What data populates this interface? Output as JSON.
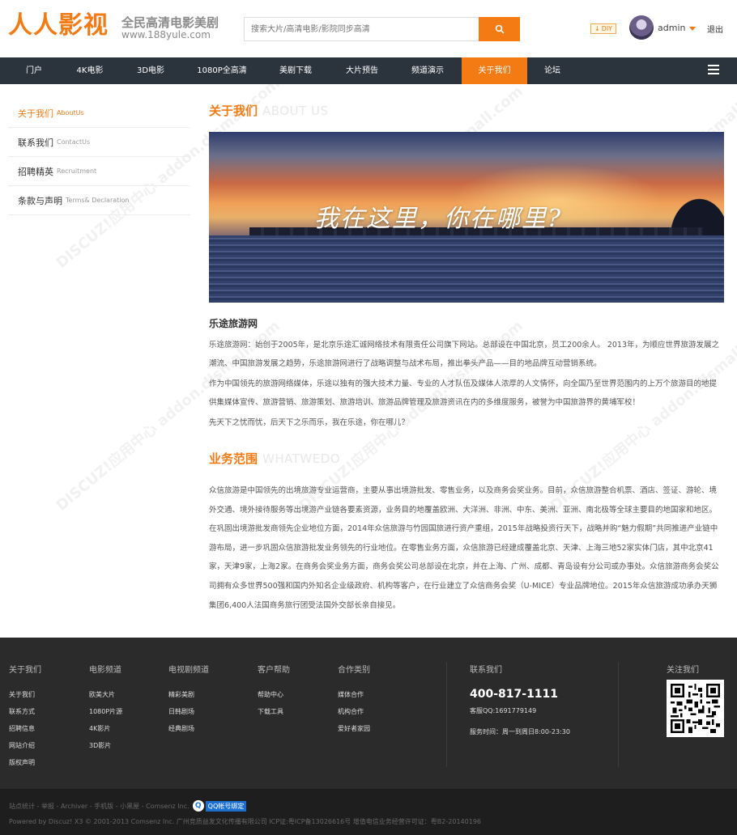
{
  "header": {
    "logo_main": "人人影视",
    "logo_tagline": "全民高清电影美剧",
    "logo_url": "www.188yule.com",
    "search_placeholder": "搜索大片/高清电影/影院同步高清",
    "diy_label": "DIY",
    "username": "admin",
    "logout_label": "退出"
  },
  "nav": {
    "items": [
      {
        "label": "门户"
      },
      {
        "label": "4K电影"
      },
      {
        "label": "3D电影"
      },
      {
        "label": "1080P全高清"
      },
      {
        "label": "美剧下载"
      },
      {
        "label": "大片预告"
      },
      {
        "label": "频道演示"
      },
      {
        "label": "关于我们",
        "active": true
      },
      {
        "label": "论坛"
      }
    ]
  },
  "sidebar": {
    "items": [
      {
        "cn": "关于我们",
        "en": "AboutUs",
        "active": true
      },
      {
        "cn": "联系我们",
        "en": "ContactUs"
      },
      {
        "cn": "招聘精英",
        "en": "Recruitment"
      },
      {
        "cn": "条款与声明",
        "en": "Terms& Declaration"
      }
    ]
  },
  "about": {
    "title_cn": "关于我们",
    "title_en": "ABOUT US",
    "banner_text": "我在这里，你在哪里?",
    "company": "乐途旅游网",
    "paragraphs": [
      "乐途旅游网：始创于2005年，是北京乐途汇诚网络技术有限责任公司旗下网站。总部设在中国北京，员工200余人。 2013年，为顺应世界旅游发展之潮流、中国旅游发展之趋势，乐途旅游网进行了战略调整与战术布局，推出拳头产品——目的地品牌互动营销系统。",
      "作为中国领先的旅游网络媒体，乐途以独有的强大技术力量、专业的人才队伍及媒体人浓厚的人文情怀，向全国乃至世界范围内的上万个旅游目的地提供集媒体宣传、旅游营销、旅游策划、旅游培训、旅游品牌管理及旅游资讯在内的多维度服务，被誉为中国旅游界的黄埔军校！",
      "先天下之忧而忧，后天下之乐而乐，我在乐途，你在哪儿？"
    ]
  },
  "business": {
    "title_cn": "业务范围",
    "title_en": "WHATWEDO",
    "text": "众信旅游是中国领先的出境旅游专业运营商，主要从事出境游批发、零售业务，以及商务会奖业务。目前，众信旅游整合机票、酒店、签证、游轮、境外交通、境外接待服务等出境游产业链各要素资源，业务目的地覆盖欧洲、大洋洲、非洲、中东、美洲、亚洲、南北极等全球主要目的地国家和地区。在巩固出境游批发商领先企业地位方面，2014年众信旅游与竹园国旅进行资产重组，2015年战略投资行天下，战略并购“魅力假期”共同推进产业链中游布局，进一步巩固众信旅游批发业务领先的行业地位。在零售业务方面，众信旅游已经建成覆盖北京、天津、上海三地52家实体门店，其中北京41家，天津9家，上海2家。在商务会奖业务方面，商务会奖公司总部设在北京，并在上海、广州、成都、青岛设有分公司或办事处。众信旅游商务会奖公司拥有众多世界500强和国内外知名企业级政府、机构等客户，在行业建立了众信商务会奖（U-MICE）专业品牌地位。2015年众信旅游成功承办天狮集团6,400人法国商务旅行团受法国外交部长亲自接见。"
  },
  "footer": {
    "cols": [
      {
        "head": "关于我们",
        "links": [
          "关于我们",
          "联系方式",
          "招聘信息",
          "网站介绍",
          "版权声明"
        ]
      },
      {
        "head": "电影频道",
        "links": [
          "欧美大片",
          "1080P片源",
          "4K影片",
          "3D影片"
        ]
      },
      {
        "head": "电视剧频道",
        "links": [
          "精彩美剧",
          "日韩剧场",
          "经典剧场"
        ]
      },
      {
        "head": "客户帮助",
        "links": [
          "帮助中心",
          "下载工具"
        ]
      },
      {
        "head": "合作类别",
        "links": [
          "媒体合作",
          "机构合作",
          "爱好者家园"
        ]
      }
    ],
    "contact": {
      "head": "联系我们",
      "phone": "400-817-1111",
      "qq": "客服QQ:1691779149",
      "hours": "服务时间：周一到周日8:00-23:30"
    },
    "follow_head": "关注我们"
  },
  "bottom": {
    "line1": "站点统计 - 举报 - Archiver - 手机版 - 小黑屋 - Comsenz Inc.",
    "qq_bind": "QQ帐号绑定",
    "line2": "Powered by Discuz! X3  © 2001-2013 Comsenz Inc.  广州竞质益发文化传播有限公司 ICP证:粤ICP备13026616号 增值电信业务经营许可证：粤B2-20140196"
  },
  "colors": {
    "accent": "#f47a14",
    "nav_bg": "#2b333d",
    "footer_bg": "#2b2b2b"
  }
}
